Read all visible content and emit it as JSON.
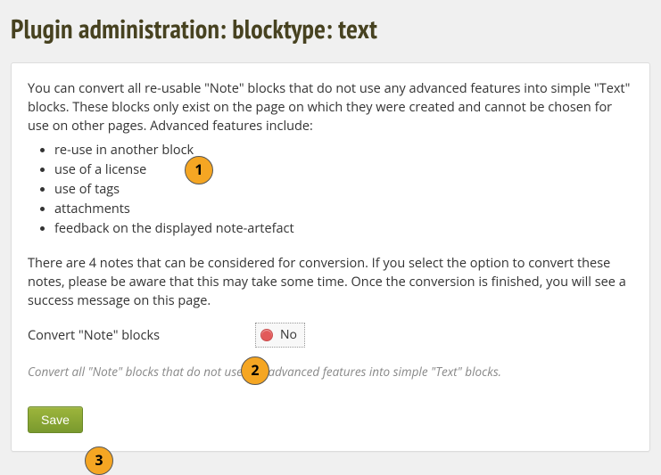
{
  "heading": "Plugin administration: blocktype: text",
  "intro": "You can convert all re-usable \"Note\" blocks that do not use any advanced features into simple \"Text\" blocks. These blocks only exist on the page on which they were created and cannot be chosen for use on other pages. Advanced features include:",
  "features": [
    "re-use in another block",
    "use of a license",
    "use of tags",
    "attachments",
    "feedback on the displayed note-artefact"
  ],
  "notes_info": "There are 4 notes that can be considered for conversion. If you select the option to convert these notes, please be aware that this may take some time. Once the conversion is finished, you will see a success message on this page.",
  "form": {
    "convert_label": "Convert \"Note\" blocks",
    "toggle_value": "No"
  },
  "help_text": "Convert all \"Note\" blocks that do not use any advanced features into simple \"Text\" blocks.",
  "save_label": "Save",
  "callouts": {
    "one": "1",
    "two": "2",
    "three": "3"
  }
}
